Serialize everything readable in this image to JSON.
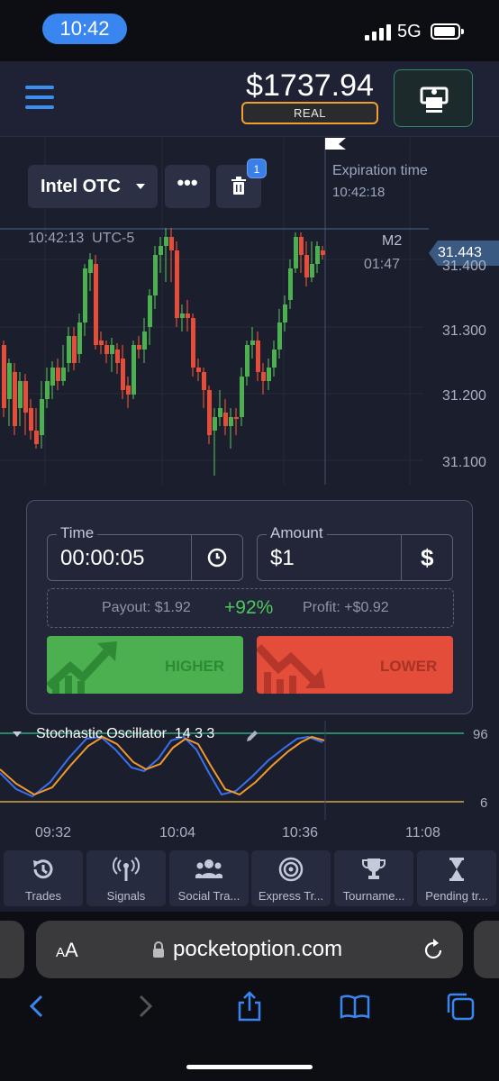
{
  "status_bar": {
    "time": "10:42",
    "network": "5G"
  },
  "header": {
    "balance": "$1737.94",
    "account_type": "REAL"
  },
  "chart": {
    "asset": "Intel OTC",
    "more_label": "•••",
    "trash_badge": "1",
    "server_time": "10:42:13",
    "timezone": "UTC-5",
    "expiration_label": "Expiration time",
    "expiration_time": "10:42:18",
    "timeframe": "M2",
    "timeframe_countdown": "01:47",
    "current_price": "31.443",
    "y_ticks": [
      "31.400",
      "31.300",
      "31.200",
      "31.100"
    ],
    "x_ticks": [
      "09:32",
      "10:04",
      "10:36",
      "11:08"
    ]
  },
  "trade": {
    "time_label": "Time",
    "time_value": "00:00:05",
    "amount_label": "Amount",
    "amount_value": "$1",
    "currency_symbol": "$",
    "payout": "Payout: $1.92",
    "percent": "+92%",
    "profit": "Profit: +$0.92",
    "higher_label": "HIGHER",
    "lower_label": "LOWER"
  },
  "indicator": {
    "title": "Stochastic Oscillator",
    "params": "14 3 3",
    "upper_level": "96",
    "lower_level": "6"
  },
  "bottom_nav": [
    {
      "label": "Trades",
      "icon": "history-icon"
    },
    {
      "label": "Signals",
      "icon": "signal-icon"
    },
    {
      "label": "Social Tra...",
      "icon": "users-icon"
    },
    {
      "label": "Express Tr...",
      "icon": "target-icon"
    },
    {
      "label": "Tourname...",
      "icon": "trophy-icon"
    },
    {
      "label": "Pending tr...",
      "icon": "hourglass-icon"
    }
  ],
  "browser": {
    "text_size": "AA",
    "url": "pocketoption.com"
  },
  "colors": {
    "bull": "#4caf50",
    "bear": "#e44d3a",
    "accent": "#3a86f0",
    "real_badge": "#f0a030",
    "stoch_k": "#3a6ff0",
    "stoch_d": "#f09a30"
  }
}
